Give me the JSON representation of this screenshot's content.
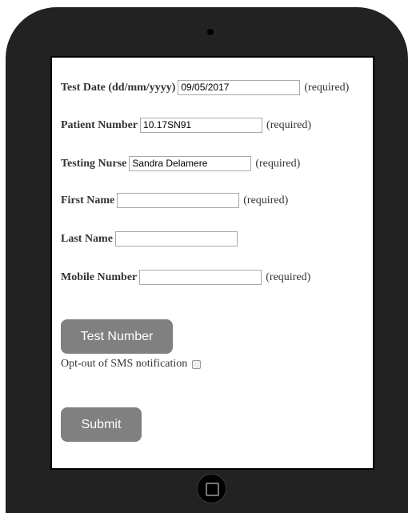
{
  "form": {
    "test_date": {
      "label": "Test Date (dd/mm/yyyy)",
      "value": "09/05/2017",
      "note": "(required)"
    },
    "patient_number": {
      "label": "Patient Number",
      "value": "10.17SN91",
      "note": "(required)"
    },
    "testing_nurse": {
      "label": "Testing Nurse",
      "value": "Sandra Delamere",
      "note": "(required)"
    },
    "first_name": {
      "label": "First Name",
      "value": "",
      "note": "(required)"
    },
    "last_name": {
      "label": "Last Name",
      "value": ""
    },
    "mobile_number": {
      "label": "Mobile Number",
      "value": "",
      "note": "(required)"
    },
    "test_number_button": "Test Number",
    "opt_out_label": "Opt-out of SMS notification",
    "submit_button": "Submit"
  }
}
